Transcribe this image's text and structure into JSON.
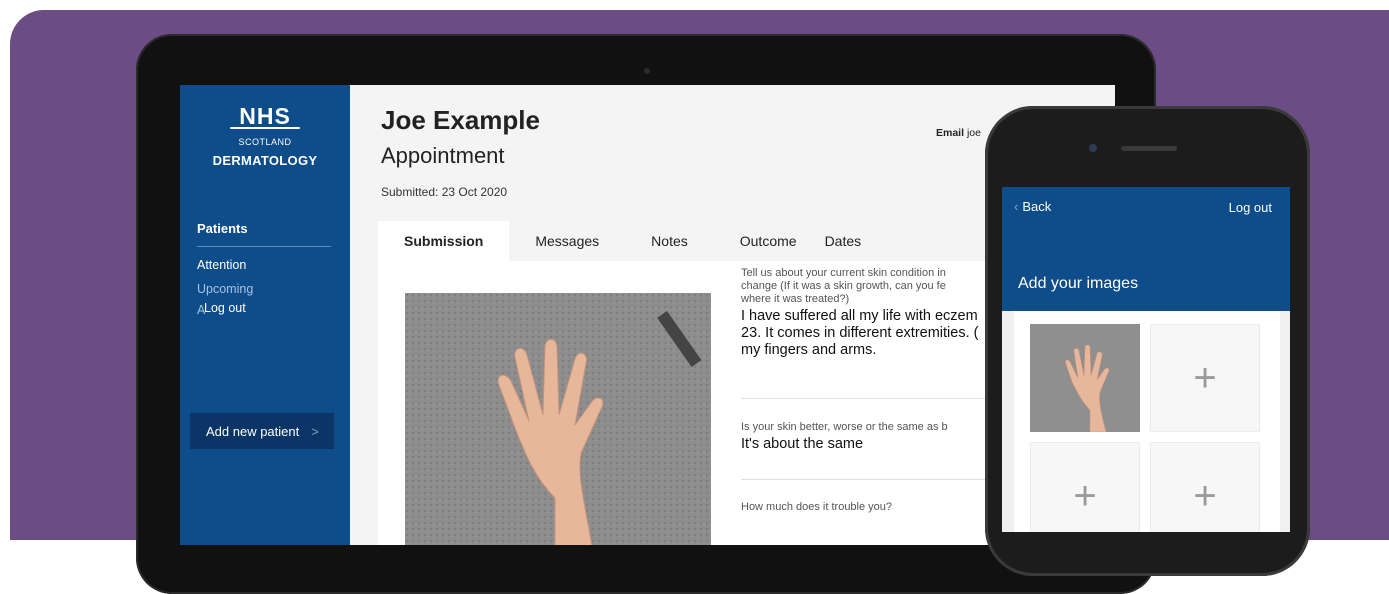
{
  "sidebar": {
    "logo_nhs": "NHS",
    "logo_scotland": "SCOTLAND",
    "logo_dermatology": "DERMATOLOGY",
    "section_heading": "Patients",
    "items": [
      {
        "label": "Attention"
      },
      {
        "label": "Upcoming"
      },
      {
        "label": "A"
      },
      {
        "label": "Log out"
      }
    ],
    "add_patient_label": "Add new patient",
    "add_patient_chevron": ">"
  },
  "header": {
    "patient_name": "Joe Example",
    "subtitle": "Appointment",
    "submitted": "Submitted: 23 Oct 2020",
    "email_label": "Email",
    "email_value": "joe"
  },
  "tabs": [
    {
      "label": "Submission",
      "active": true
    },
    {
      "label": "Messages",
      "active": false
    },
    {
      "label": "Notes",
      "active": false
    },
    {
      "label": "Outcome",
      "active": false
    },
    {
      "label": "Dates",
      "active": false
    }
  ],
  "submission": {
    "questions": [
      {
        "question_lines": [
          "Tell us about your current skin condition in",
          "change (If it was a skin growth, can you fe",
          "where it was treated?)"
        ],
        "answer_lines": [
          "I have suffered all my life with eczem",
          "23. It comes in different extremities. (",
          "my fingers and arms."
        ]
      },
      {
        "question_lines": [
          "Is your skin better, worse or the same as b"
        ],
        "answer_lines": [
          "It's about the same"
        ]
      },
      {
        "question_lines": [
          "How much does it trouble you?"
        ],
        "answer_lines": []
      }
    ]
  },
  "phone": {
    "back_label": "Back",
    "logout_label": "Log out",
    "title": "Add your images",
    "tiles": [
      {
        "kind": "image"
      },
      {
        "kind": "add",
        "icon": "plus-icon",
        "glyph": "+"
      },
      {
        "kind": "add",
        "icon": "plus-icon",
        "glyph": "+"
      },
      {
        "kind": "add",
        "icon": "plus-icon",
        "glyph": "+"
      }
    ]
  },
  "colors": {
    "background_purple": "#6b4c85",
    "nhs_blue": "#0f4c8a",
    "nhs_dark_blue": "#0a3566"
  }
}
